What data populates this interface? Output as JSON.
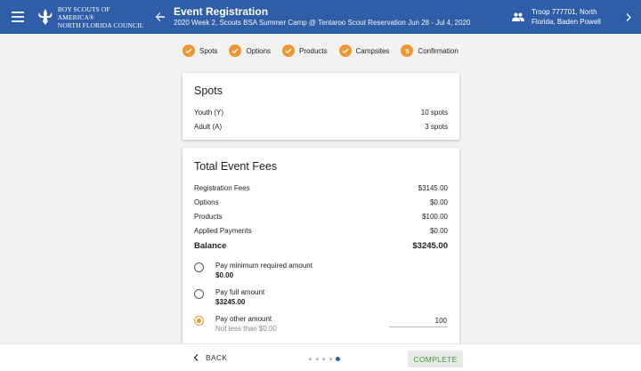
{
  "header": {
    "logo_line1": "BOY SCOUTS OF AMERICA®",
    "logo_line2": "NORTH FLORIDA COUNCIL",
    "title": "Event Registration",
    "subtitle": "2020 Week 2, Scouts BSA Summer Camp @ Tentaroo Scout Reservation Jun 28 - Jul 4, 2020",
    "unit_line1": "Troop 777701, North",
    "unit_line2": "Florida, Baden Powell"
  },
  "steps": [
    {
      "label": "Spots",
      "state": "done"
    },
    {
      "label": "Options",
      "state": "done"
    },
    {
      "label": "Products",
      "state": "done"
    },
    {
      "label": "Campsites",
      "state": "done"
    },
    {
      "label": "Confirmation",
      "state": "current",
      "number": "5"
    }
  ],
  "spots": {
    "title": "Spots",
    "rows": [
      {
        "label": "Youth (Y)",
        "value": "10 spots"
      },
      {
        "label": "Adult (A)",
        "value": "3 spots"
      }
    ]
  },
  "fees": {
    "title": "Total Event Fees",
    "rows": [
      {
        "label": "Registration Fees",
        "value": "$3145.00"
      },
      {
        "label": "Options",
        "value": "$0.00"
      },
      {
        "label": "Products",
        "value": "$100.00"
      },
      {
        "label": "Applied Payments",
        "value": "$0.00"
      }
    ],
    "balance_label": "Balance",
    "balance_value": "$3245.00",
    "options": [
      {
        "label": "Pay minimum required amount",
        "amount": "$0.00",
        "selected": false
      },
      {
        "label": "Pay full amount",
        "amount": "$3245.00",
        "selected": false
      },
      {
        "label": "Pay other amount",
        "amount": "Not less than $0.00",
        "selected": true
      }
    ],
    "other_amount_value": "100"
  },
  "footer": {
    "back_label": "BACK",
    "complete_label": "COMPLETE",
    "pager_total": 5,
    "pager_active": 5
  },
  "colors": {
    "header_bg": "#2f5ea8",
    "accent_orange": "#f0962f",
    "complete_green": "#3a9a3a"
  }
}
